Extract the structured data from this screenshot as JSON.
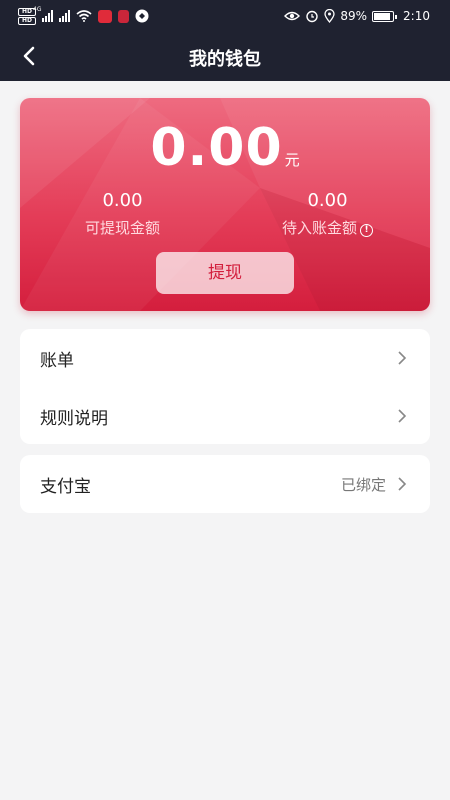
{
  "status_bar": {
    "time": "2:10",
    "battery": "89%",
    "network": "4G"
  },
  "header": {
    "title": "我的钱包"
  },
  "wallet": {
    "balance": "0.00",
    "unit": "元",
    "withdrawable_amount": "0.00",
    "withdrawable_label": "可提现金额",
    "pending_amount": "0.00",
    "pending_label": "待入账金额",
    "withdraw_button": "提现"
  },
  "menu": {
    "bill_label": "账单",
    "rules_label": "规则说明"
  },
  "payment": {
    "alipay_label": "支付宝",
    "alipay_status": "已绑定"
  },
  "colors": {
    "header_bg": "#1f2230",
    "card_accent": "#e43d58",
    "page_bg": "#f4f4f5"
  }
}
